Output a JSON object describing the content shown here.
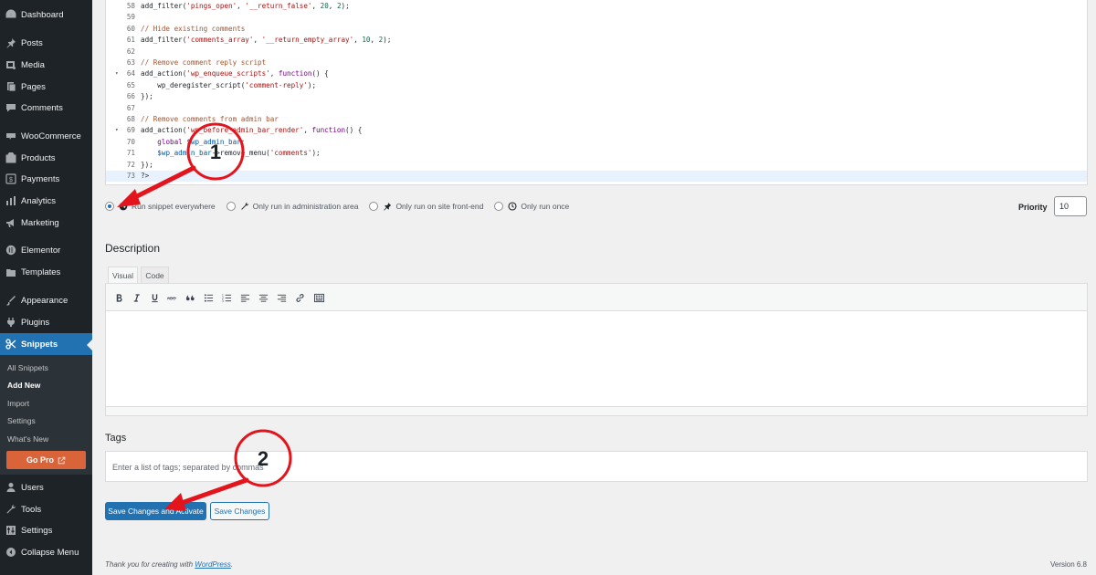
{
  "sidebar": {
    "items": [
      {
        "label": "Dashboard",
        "icon": "dashboard-icon"
      },
      {
        "label": "Posts",
        "icon": "pin-icon"
      },
      {
        "label": "Media",
        "icon": "media-icon"
      },
      {
        "label": "Pages",
        "icon": "pages-icon"
      },
      {
        "label": "Comments",
        "icon": "comments-icon"
      },
      {
        "label": "WooCommerce",
        "icon": "woocommerce-icon"
      },
      {
        "label": "Products",
        "icon": "products-icon"
      },
      {
        "label": "Payments",
        "icon": "payments-icon"
      },
      {
        "label": "Analytics",
        "icon": "analytics-icon"
      },
      {
        "label": "Marketing",
        "icon": "marketing-icon"
      },
      {
        "label": "Elementor",
        "icon": "elementor-icon"
      },
      {
        "label": "Templates",
        "icon": "templates-icon"
      },
      {
        "label": "Appearance",
        "icon": "appearance-icon"
      },
      {
        "label": "Plugins",
        "icon": "plugins-icon"
      },
      {
        "label": "Snippets",
        "icon": "snippets-icon",
        "active": true
      },
      {
        "label": "Users",
        "icon": "users-icon"
      },
      {
        "label": "Tools",
        "icon": "tools-icon"
      },
      {
        "label": "Settings",
        "icon": "settings-icon"
      },
      {
        "label": "Collapse Menu",
        "icon": "collapse-icon"
      }
    ],
    "submenu": [
      {
        "label": "All Snippets"
      },
      {
        "label": "Add New",
        "current": true
      },
      {
        "label": "Import"
      },
      {
        "label": "Settings"
      },
      {
        "label": "What's New"
      }
    ],
    "gopro_label": "Go Pro"
  },
  "editor": {
    "lines": [
      {
        "num": "58",
        "fold": false,
        "text": "add_filter('pings_open', '__return_false', 20, 2);"
      },
      {
        "num": "59",
        "fold": false,
        "text": ""
      },
      {
        "num": "60",
        "fold": false,
        "text": "// Hide existing comments"
      },
      {
        "num": "61",
        "fold": false,
        "text": "add_filter('comments_array', '__return_empty_array', 10, 2);"
      },
      {
        "num": "62",
        "fold": false,
        "text": ""
      },
      {
        "num": "63",
        "fold": false,
        "text": "// Remove comment reply script"
      },
      {
        "num": "64",
        "fold": true,
        "text": "add_action('wp_enqueue_scripts', function() {"
      },
      {
        "num": "65",
        "fold": false,
        "text": "    wp_deregister_script('comment-reply');"
      },
      {
        "num": "66",
        "fold": false,
        "text": "});"
      },
      {
        "num": "67",
        "fold": false,
        "text": ""
      },
      {
        "num": "68",
        "fold": false,
        "text": "// Remove comments from admin bar"
      },
      {
        "num": "69",
        "fold": true,
        "text": "add_action('wp_before_admin_bar_render', function() {"
      },
      {
        "num": "70",
        "fold": false,
        "text": "    global $wp_admin_bar;"
      },
      {
        "num": "71",
        "fold": false,
        "text": "    $wp_admin_bar->remove_menu('comments');"
      },
      {
        "num": "72",
        "fold": false,
        "text": "});"
      },
      {
        "num": "73",
        "fold": false,
        "text": "?>"
      }
    ]
  },
  "scope": {
    "options": [
      {
        "label": "Run snippet everywhere",
        "icon": "globe-icon",
        "checked": true
      },
      {
        "label": "Only run in administration area",
        "icon": "wrench-icon",
        "checked": false
      },
      {
        "label": "Only run on site front-end",
        "icon": "pushpin-icon",
        "checked": false
      },
      {
        "label": "Only run once",
        "icon": "clock-icon",
        "checked": false
      }
    ],
    "priority_label": "Priority",
    "priority_value": "10"
  },
  "description": {
    "title": "Description",
    "tabs": [
      "Visual",
      "Code"
    ],
    "toolbar": [
      "bold-icon",
      "italic-icon",
      "underline-icon",
      "strikethrough-icon",
      "blockquote-icon",
      "bullet-list-icon",
      "numbered-list-icon",
      "align-left-icon",
      "align-center-icon",
      "align-right-icon",
      "link-icon",
      "toolbar-toggle-icon"
    ]
  },
  "tags": {
    "title": "Tags",
    "placeholder": "Enter a list of tags; separated by commas"
  },
  "buttons": {
    "save_activate": "Save Changes and Activate",
    "save": "Save Changes"
  },
  "footer": {
    "thanks_prefix": "Thank you for creating with ",
    "thanks_link": "WordPress",
    "thanks_suffix": ".",
    "version": "Version 6.8"
  },
  "annotations": {
    "callout_1": "1",
    "callout_2": "2",
    "accent": "#e3141b"
  }
}
